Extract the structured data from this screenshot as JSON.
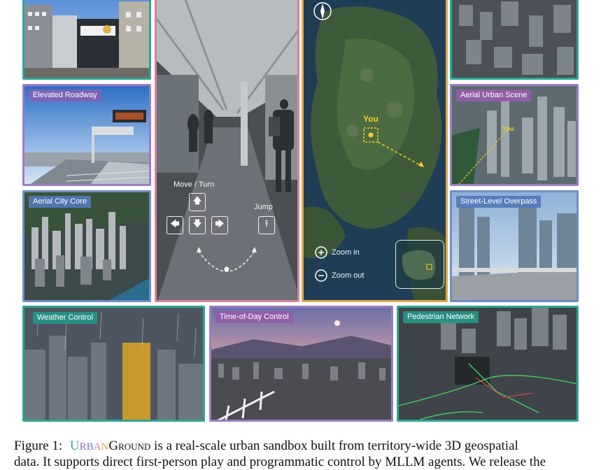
{
  "panels": {
    "street_scene": {
      "label": ""
    },
    "elevated_roadway": {
      "label": "Elevated Roadway"
    },
    "aerial_city_core": {
      "label": "Aerial City Core"
    },
    "aerial_top_right": {
      "label": ""
    },
    "aerial_urban_scene": {
      "label": "Aerial Urban Scene",
      "marker": "You"
    },
    "street_level_overpass": {
      "label": "Street-Level Overpass"
    },
    "weather_control": {
      "label": "Weather Control"
    },
    "time_of_day_control": {
      "label": "Time-of-Day Control"
    },
    "pedestrian_network": {
      "label": "Pedestrian Network"
    }
  },
  "first_person": {
    "move_turn_label": "Move / Turn",
    "jump_label": "Jump",
    "keys": {
      "up": "🡅",
      "left": "🡄",
      "down": "🡇",
      "right": "🡆",
      "jump": "⭱"
    }
  },
  "map_view": {
    "you_marker": "You",
    "zoom_in_label": "Zoom in",
    "zoom_out_label": "Zoom out"
  },
  "caption": {
    "figure_label": "Figure 1:",
    "system_name_letters": [
      "U",
      "R",
      "B",
      "A",
      "N"
    ],
    "system_name_rest": "Ground",
    "line1_rest": " is a real-scale urban sandbox built from territory-wide 3D geospatial",
    "line2": "data. It supports direct first-person play and programmatic control by MLLM agents. We release the"
  },
  "colors": {
    "teal": "#2fa595",
    "purple": "#9b7ec4",
    "blue": "#6d8fc4",
    "pink": "#d8829b",
    "orange": "#e3a84a",
    "marker_yellow": "#f5d020",
    "name_u": "#3aa6a0",
    "name_r": "#8a6cc0",
    "name_b": "#5b83c8",
    "name_a": "#d8829b",
    "name_n": "#e3a84a"
  }
}
